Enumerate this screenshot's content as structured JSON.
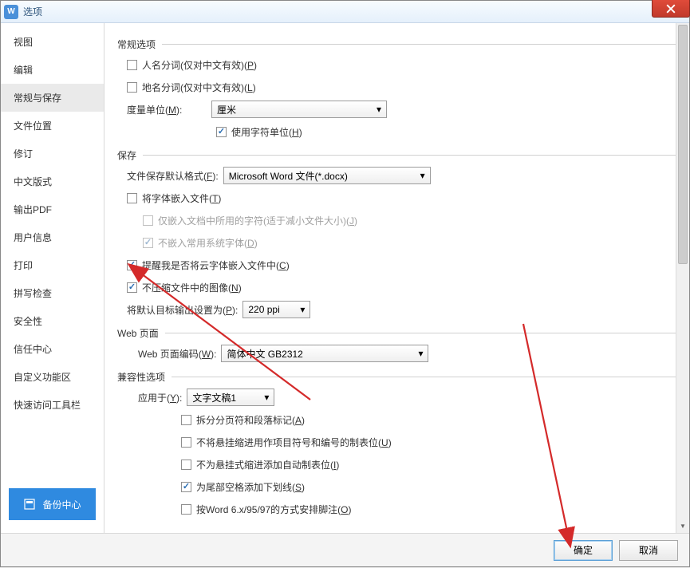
{
  "title": "选项",
  "sidebar": {
    "items": [
      {
        "label": "视图"
      },
      {
        "label": "编辑"
      },
      {
        "label": "常规与保存"
      },
      {
        "label": "文件位置"
      },
      {
        "label": "修订"
      },
      {
        "label": "中文版式"
      },
      {
        "label": "输出PDF"
      },
      {
        "label": "用户信息"
      },
      {
        "label": "打印"
      },
      {
        "label": "拼写检查"
      },
      {
        "label": "安全性"
      },
      {
        "label": "信任中心"
      },
      {
        "label": "自定义功能区"
      },
      {
        "label": "快速访问工具栏"
      }
    ],
    "active_index": 2,
    "backup_label": "备份中心"
  },
  "groups": {
    "general": {
      "title": "常规选项",
      "person_seg": "人名分词(仅对中文有效)",
      "person_seg_key": "P",
      "place_seg": "地名分词(仅对中文有效)",
      "place_seg_key": "L",
      "unit_label": "度量单位",
      "unit_key": "M",
      "unit_value": "厘米",
      "char_unit": "使用字符单位",
      "char_unit_key": "H"
    },
    "save": {
      "title": "保存",
      "default_format_label": "文件保存默认格式",
      "default_format_key": "F",
      "default_format_value": "Microsoft Word 文件(*.docx)",
      "embed_fonts": "将字体嵌入文件",
      "embed_fonts_key": "T",
      "embed_used_only": "仅嵌入文档中所用的字符(适于减小文件大小)",
      "embed_used_only_key": "J",
      "no_embed_system": "不嵌入常用系统字体",
      "no_embed_system_key": "D",
      "remind_cloud": "提醒我是否将云字体嵌入文件中",
      "remind_cloud_key": "C",
      "no_compress_img": "不压缩文件中的图像",
      "no_compress_img_key": "N",
      "default_target_label": "将默认目标输出设置为",
      "default_target_key": "P",
      "default_target_value": "220 ppi"
    },
    "web": {
      "title": "Web 页面",
      "encoding_label": "Web 页面编码",
      "encoding_key": "W",
      "encoding_value": "简体中文 GB2312"
    },
    "compat": {
      "title": "兼容性选项",
      "apply_label": "应用于",
      "apply_key": "Y",
      "apply_value": "文字文稿1",
      "split_page": "拆分分页符和段落标记",
      "split_page_key": "A",
      "no_hang_indent": "不将悬挂缩进用作项目符号和编号的制表位",
      "no_hang_indent_key": "U",
      "no_auto_tab": "不为悬挂式缩进添加自动制表位",
      "no_auto_tab_key": "I",
      "tail_underline": "为尾部空格添加下划线",
      "tail_underline_key": "S",
      "word6_layout": "按Word 6.x/95/97的方式安排脚注",
      "word6_layout_key": "O"
    }
  },
  "buttons": {
    "ok": "确定",
    "cancel": "取消"
  },
  "colors": {
    "accent": "#2f8ae0",
    "arrow": "#d42a2a"
  }
}
